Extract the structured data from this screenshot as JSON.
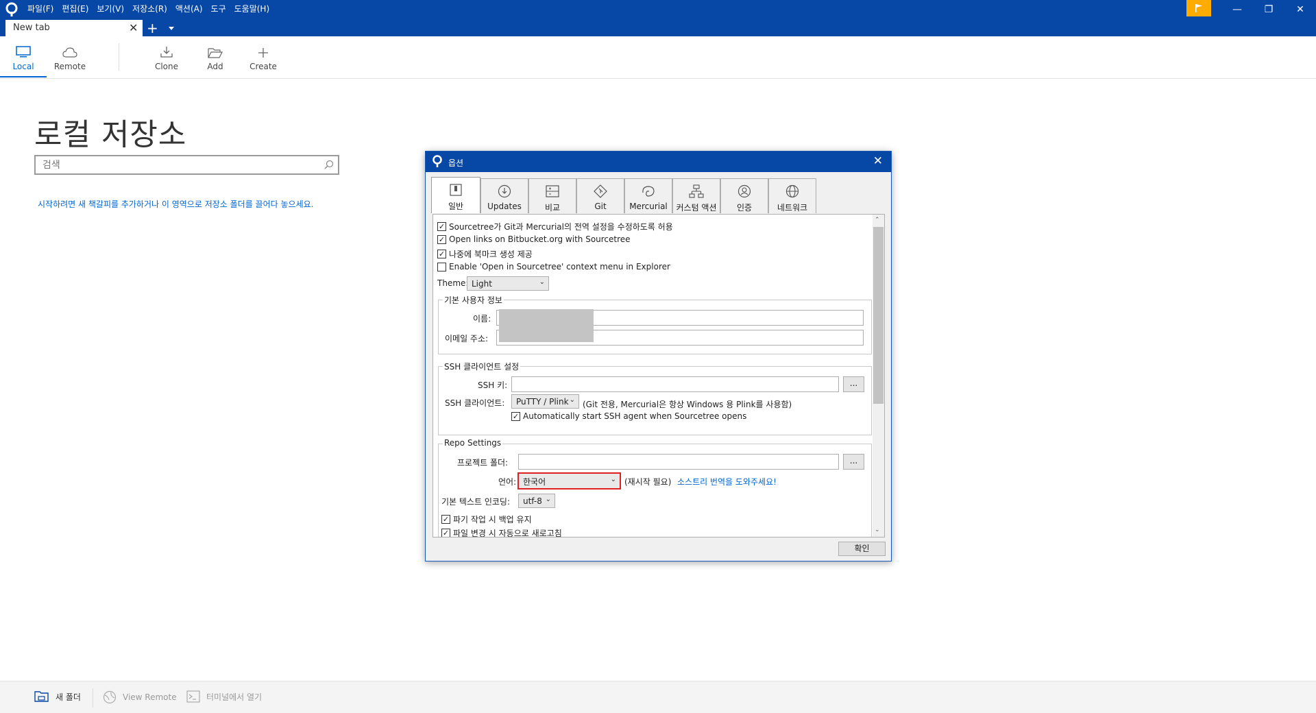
{
  "menu": [
    "파일(F)",
    "편집(E)",
    "보기(V)",
    "저장소(R)",
    "액션(A)",
    "도구",
    "도움말(H)"
  ],
  "tab": {
    "label": "New tab",
    "close": "✕",
    "add": "+"
  },
  "toolbar": {
    "local": "Local",
    "remote": "Remote",
    "clone": "Clone",
    "add": "Add",
    "create": "Create"
  },
  "main": {
    "title": "로컬 저장소",
    "search_placeholder": "검색",
    "hint": "시작하려면 새 책갈피를 추가하거나 이 영역으로 저장소 폴더를 끌어다 놓으세요."
  },
  "bottom": {
    "new_folder": "새 폴더",
    "view_remote": "View Remote",
    "terminal": "터미널에서 열기"
  },
  "dialog": {
    "title": "옵션",
    "close": "✕",
    "tabs": [
      "일반",
      "Updates",
      "비교",
      "Git",
      "Mercurial",
      "커스텀 액션",
      "인증",
      "네트워크"
    ],
    "active_tab": "일반",
    "checks": [
      {
        "label": "Sourcetree가 Git과 Mercurial의 전역 설정을 수정하도록 허용",
        "checked": true
      },
      {
        "label": "Open links on Bitbucket.org with Sourcetree",
        "checked": true
      },
      {
        "label": "나중에 북마크 생성 제공",
        "checked": true
      },
      {
        "label": "Enable 'Open in Sourcetree' context menu in Explorer",
        "checked": false
      }
    ],
    "theme_label": "Theme:",
    "theme_value": "Light",
    "user_group": {
      "title": "기본 사용자 정보",
      "name_label": "이름:",
      "email_label": "이메일 주소:"
    },
    "ssh_group": {
      "title": "SSH 클라이언트 설정",
      "key_label": "SSH 키:",
      "client_label": "SSH 클라이언트:",
      "client_value": "PuTTY / Plink",
      "client_note": "(Git 전용, Mercurial은 항상 Windows 용 Plink를 사용함)",
      "agent_label": "Automatically start SSH agent when Sourcetree opens",
      "agent_checked": true,
      "browse": "..."
    },
    "repo_group": {
      "title": "Repo Settings",
      "project_label": "프로젝트 폴더:",
      "language_label": "언어:",
      "language_value": "한국어",
      "restart_note": "(재시작 필요)",
      "translate_link": "소스트리 번역을 도와주세요!",
      "encoding_label": "기본 텍스트 인코딩:",
      "encoding_value": "utf-8",
      "backup_label": "파기 작업 시 백업 유지",
      "refresh_label": "파일 변경 시 자동으로 새로고침",
      "browse": "..."
    },
    "ok": "확인"
  },
  "colors": {
    "titlebar": "#0747a6",
    "accent": "#0065d1",
    "flag": "#ffab00",
    "highlight": "#e02020"
  }
}
